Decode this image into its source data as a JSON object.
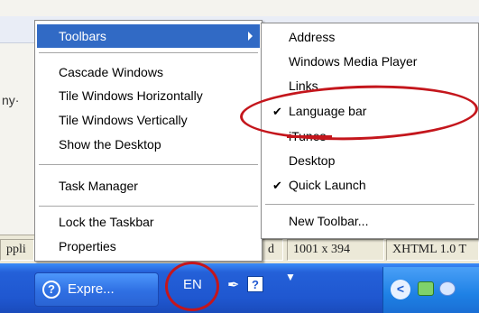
{
  "background": {
    "left_text": "ny·",
    "left_text2": "ppli",
    "status_size": "1001 x 394",
    "status_doctype": "XHTML 1.0 T",
    "status_partial": "d"
  },
  "context_menu": {
    "toolbars": "Toolbars",
    "cascade": "Cascade Windows",
    "tile_h": "Tile Windows Horizontally",
    "tile_v": "Tile Windows Vertically",
    "show_desktop": "Show the Desktop",
    "task_manager": "Task Manager",
    "lock_taskbar": "Lock the Taskbar",
    "properties": "Properties"
  },
  "toolbars_submenu": {
    "address": "Address",
    "wmp": "Windows Media Player",
    "links": "Links",
    "language_bar": "Language bar",
    "itunes": "iTunes",
    "desktop": "Desktop",
    "quick_launch": "Quick Launch",
    "new_toolbar": "New Toolbar...",
    "checkmark": "✔"
  },
  "taskbar": {
    "task_button_label": "Expre...",
    "task_icon_glyph": "?",
    "language_indicator": "EN",
    "help_glyph": "?",
    "tray_chevron": "<"
  },
  "colors": {
    "menu_highlight": "#316ac5",
    "annotation_red": "#c4161c",
    "taskbar_blue": "#245edb"
  }
}
